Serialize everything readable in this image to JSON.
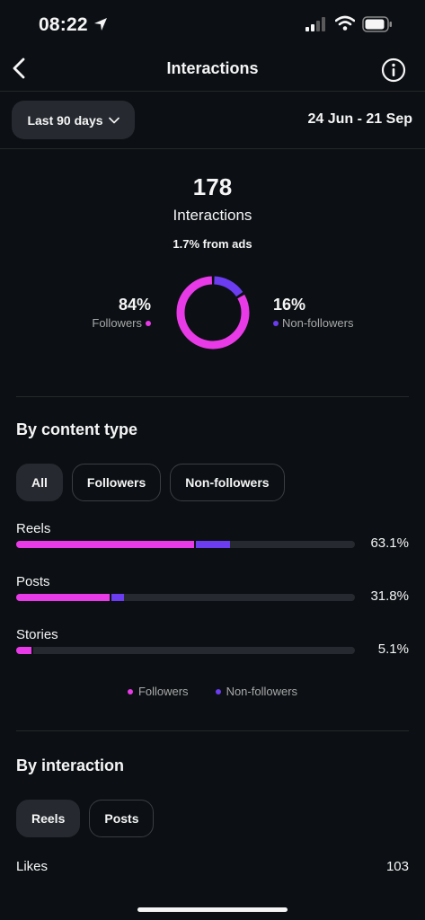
{
  "status": {
    "time": "08:22"
  },
  "nav": {
    "title": "Interactions"
  },
  "range": {
    "label": "Last 90 days",
    "dates": "24 Jun - 21 Sep"
  },
  "summary": {
    "total": "178",
    "label": "Interactions",
    "ads": "1.7% from ads",
    "followers_pct": "84%",
    "followers_label": "Followers",
    "non_followers_pct": "16%",
    "non_followers_label": "Non-followers",
    "followers_fraction": 0.84,
    "non_followers_fraction": 0.16
  },
  "content_type": {
    "title": "By content type",
    "chips": [
      "All",
      "Followers",
      "Non-followers"
    ],
    "active_chip": "All",
    "items": [
      {
        "label": "Reels",
        "pct": "63.1%",
        "followers": 0.526,
        "non_followers": 0.105
      },
      {
        "label": "Posts",
        "pct": "31.8%",
        "followers": 0.275,
        "non_followers": 0.043
      },
      {
        "label": "Stories",
        "pct": "5.1%",
        "followers": 0.045,
        "non_followers": 0.006
      }
    ],
    "legend": [
      "Followers",
      "Non-followers"
    ]
  },
  "by_interaction": {
    "title": "By interaction",
    "chips": [
      "Reels",
      "Posts"
    ],
    "active_chip": "Reels",
    "rows": [
      {
        "label": "Likes",
        "value": "103"
      }
    ]
  },
  "colors": {
    "followers": "#e83ae6",
    "non_followers": "#6b3cf0",
    "background": "#0c1014"
  }
}
